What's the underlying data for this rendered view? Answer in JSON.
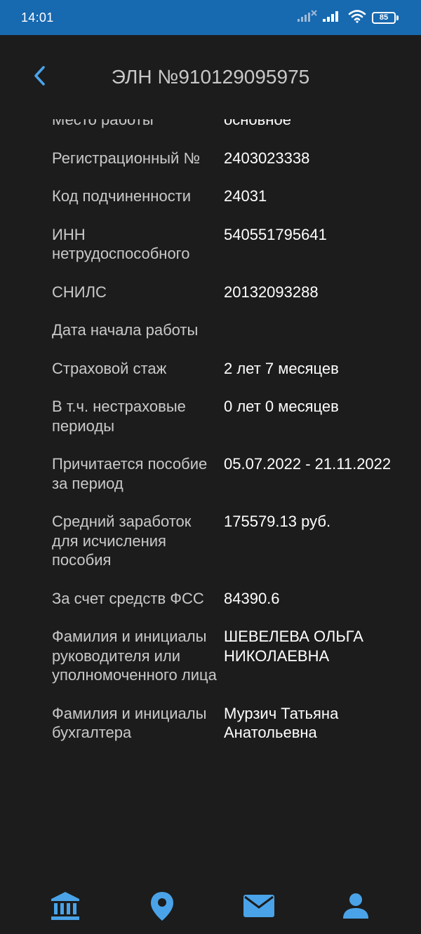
{
  "status_bar": {
    "time": "14:01",
    "battery": "85",
    "icons": [
      "signal-x-icon",
      "signal-icon",
      "wifi-icon",
      "battery-icon"
    ]
  },
  "header": {
    "title": "ЭЛН №910129095975",
    "back_icon": "chevron-left-icon"
  },
  "fields": [
    {
      "label": "Место работы",
      "value": "основное"
    },
    {
      "label": "Регистрационный №",
      "value": "2403023338"
    },
    {
      "label": "Код подчиненности",
      "value": "24031"
    },
    {
      "label": "ИНН нетрудоспособного",
      "value": "540551795641"
    },
    {
      "label": "СНИЛС",
      "value": "20132093288"
    },
    {
      "label": "Дата начала работы",
      "value": ""
    },
    {
      "label": "Страховой стаж",
      "value": "2 лет 7 месяцев"
    },
    {
      "label": "В т.ч. нестраховые периоды",
      "value": "0 лет 0 месяцев"
    },
    {
      "label": "Причитается пособие за период",
      "value": "05.07.2022 - 21.11.2022"
    },
    {
      "label": "Средний заработок для исчисления пособия",
      "value": "175579.13 руб."
    },
    {
      "label": "За счет средств ФСС",
      "value": "84390.6"
    },
    {
      "label": "Фамилия и инициалы руководителя или уполномоченного лица",
      "value": "ШЕВЕЛЕВА ОЛЬГА НИКОЛАЕВНА"
    },
    {
      "label": "Фамилия и инициалы бухгалтера",
      "value": "Мурзич Татьяна Анатольевна"
    }
  ],
  "bottom_nav": [
    {
      "name": "bank-icon"
    },
    {
      "name": "location-pin-icon"
    },
    {
      "name": "mail-icon"
    },
    {
      "name": "user-icon",
      "active": true
    }
  ],
  "colors": {
    "status_bar": "#1769b0",
    "background": "#1c1c1c",
    "accent": "#4aa3e8",
    "label": "#c9c9c9",
    "value": "#ffffff"
  }
}
